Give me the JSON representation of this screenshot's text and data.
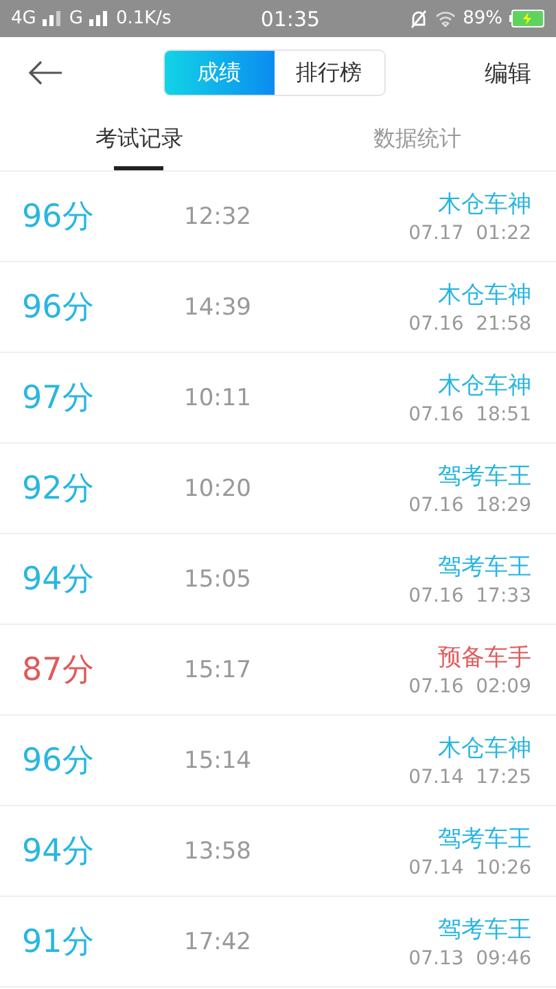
{
  "status_bar": {
    "network_1": "4G",
    "network_2": "G",
    "speed": "0.1K/s",
    "time": "01:35",
    "battery": "89%"
  },
  "header": {
    "segments": [
      {
        "label": "成绩",
        "selected": true
      },
      {
        "label": "排行榜",
        "selected": false
      }
    ],
    "action": "编辑"
  },
  "tabs": [
    {
      "label": "考试记录",
      "selected": true
    },
    {
      "label": "数据统计",
      "selected": false
    }
  ],
  "records": [
    {
      "score": "96分",
      "duration": "12:32",
      "title": "木仓车神",
      "date": "07.17  01:22",
      "color": "#29b6e0"
    },
    {
      "score": "96分",
      "duration": "14:39",
      "title": "木仓车神",
      "date": "07.16  21:58",
      "color": "#29b6e0"
    },
    {
      "score": "97分",
      "duration": "10:11",
      "title": "木仓车神",
      "date": "07.16  18:51",
      "color": "#29b6e0"
    },
    {
      "score": "92分",
      "duration": "10:20",
      "title": "驾考车王",
      "date": "07.16  18:29",
      "color": "#29b6e0"
    },
    {
      "score": "94分",
      "duration": "15:05",
      "title": "驾考车王",
      "date": "07.16  17:33",
      "color": "#29b6e0"
    },
    {
      "score": "87分",
      "duration": "15:17",
      "title": "预备车手",
      "date": "07.16  02:09",
      "color": "#e05a5a"
    },
    {
      "score": "96分",
      "duration": "15:14",
      "title": "木仓车神",
      "date": "07.14  17:25",
      "color": "#29b6e0"
    },
    {
      "score": "94分",
      "duration": "13:58",
      "title": "驾考车王",
      "date": "07.14  10:26",
      "color": "#29b6e0"
    },
    {
      "score": "91分",
      "duration": "17:42",
      "title": "驾考车王",
      "date": "07.13  09:46",
      "color": "#29b6e0"
    }
  ]
}
